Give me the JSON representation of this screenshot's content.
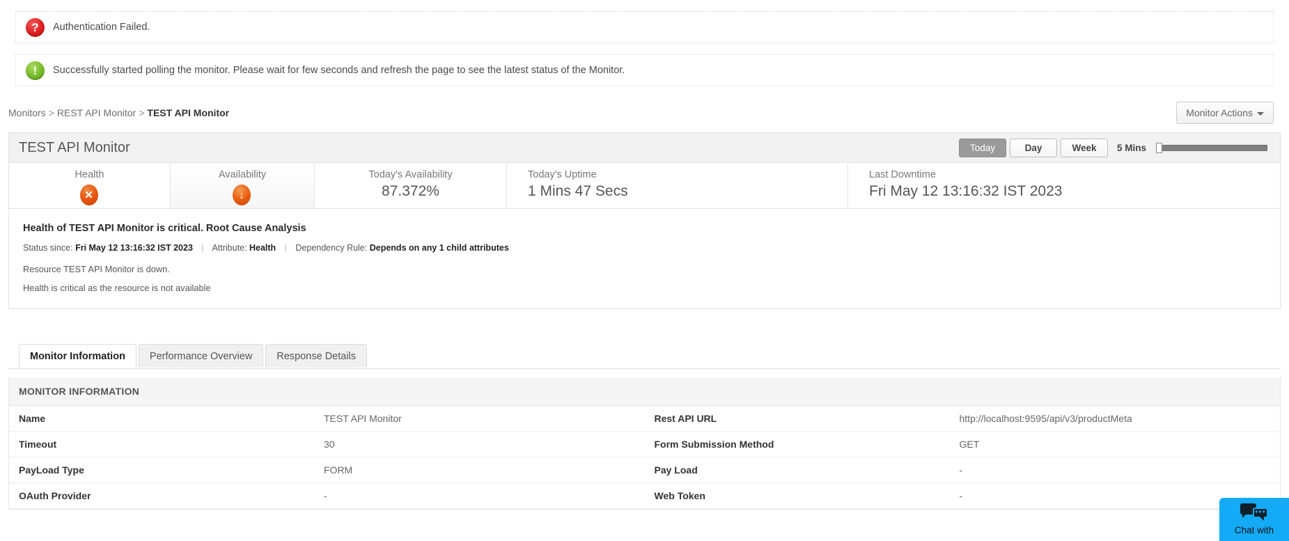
{
  "alerts": [
    {
      "icon": "question-mark-icon",
      "type": "error",
      "symbol": "?",
      "text": "Authentication Failed."
    },
    {
      "icon": "exclamation-icon",
      "type": "success",
      "symbol": "!",
      "text": "Successfully started polling the monitor. Please wait for few seconds and refresh the page to see the latest status of the Monitor."
    }
  ],
  "breadcrumb": {
    "root": "Monitors",
    "sep1": ">",
    "parent": "REST API Monitor",
    "sep2": ">",
    "current": "TEST API Monitor"
  },
  "monitor_actions_label": "Monitor Actions",
  "panel": {
    "title": "TEST API Monitor",
    "range_buttons": [
      {
        "label": "Today",
        "active": true
      },
      {
        "label": "Day",
        "active": false
      },
      {
        "label": "Week",
        "active": false
      }
    ],
    "interval_label": "5 Mins"
  },
  "stats": [
    {
      "label": "Health",
      "value": "",
      "icon": "critical-x-icon",
      "symbol": "✕",
      "align": "center"
    },
    {
      "label": "Availability",
      "value": "",
      "icon": "down-arrow-icon",
      "symbol": "↓",
      "align": "center"
    },
    {
      "label": "Today's Availability",
      "value": "87.372%",
      "align": "center"
    },
    {
      "label": "Today's Uptime",
      "value": "1 Mins 47 Secs",
      "align": "left"
    },
    {
      "label": "Last Downtime",
      "value": "Fri May 12 13:16:32 IST 2023",
      "align": "left"
    }
  ],
  "rca": {
    "title": "Health of TEST API Monitor is critical. Root Cause Analysis",
    "status_since_label": "Status since:",
    "status_since_value": "Fri May 12 13:16:32 IST 2023",
    "attribute_label": "Attribute:",
    "attribute_value": "Health",
    "dependency_label": "Dependency Rule:",
    "dependency_value": "Depends on any 1 child attributes",
    "line1": "Resource TEST API Monitor is down.",
    "line2": "Health is critical as the resource is not available"
  },
  "tabs": [
    {
      "label": "Monitor Information",
      "active": true
    },
    {
      "label": "Performance Overview",
      "active": false
    },
    {
      "label": "Response Details",
      "active": false
    }
  ],
  "monitor_information": {
    "section_title": "MONITOR INFORMATION",
    "rows": [
      {
        "k1": "Name",
        "v1": "TEST API Monitor",
        "k2": "Rest API URL",
        "v2": "http://localhost:9595/api/v3/productMeta"
      },
      {
        "k1": "Timeout",
        "v1": "30",
        "k2": "Form Submission Method",
        "v2": "GET"
      },
      {
        "k1": "PayLoad Type",
        "v1": "FORM",
        "k2": "Pay Load",
        "v2": "-"
      },
      {
        "k1": "OAuth Provider",
        "v1": "-",
        "k2": "Web Token",
        "v2": "-"
      }
    ]
  },
  "chat": {
    "label": "Chat with",
    "icon": "chat-bubbles-icon"
  },
  "colors": {
    "error_red": "#e02020",
    "success_green": "#76bb2b",
    "critical_orange": "#e8560f",
    "chat_blue": "#14aaf5",
    "active_button_gray": "#9a9a9a"
  }
}
